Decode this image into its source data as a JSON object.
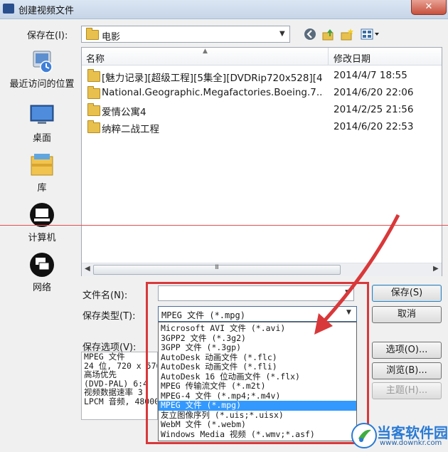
{
  "window": {
    "title": "创建视频文件",
    "close_label": "✕",
    "app_icon_text": ""
  },
  "toolbar": {
    "save_in_label": "保存在(I):",
    "current_folder": "电影"
  },
  "places": [
    {
      "label": "最近访问的位置",
      "icon": "recent-places-icon"
    },
    {
      "label": "桌面",
      "icon": "desktop-icon"
    },
    {
      "label": "库",
      "icon": "libraries-icon"
    },
    {
      "label": "计算机",
      "icon": "computer-icon"
    },
    {
      "label": "网络",
      "icon": "network-icon"
    }
  ],
  "file_list": {
    "columns": {
      "name": "名称",
      "date": "修改日期"
    },
    "rows": [
      {
        "name": "[魅力记录][超级工程][5集全][DVDRip720x528][4...",
        "date": "2014/4/7 18:55"
      },
      {
        "name": "National.Geographic.Megafactories.Boeing.7...",
        "date": "2014/6/20 22:06"
      },
      {
        "name": "爱情公寓4",
        "date": "2014/2/25 21:56"
      },
      {
        "name": "纳粹二战工程",
        "date": "2014/6/20 22:53"
      }
    ],
    "scroll_grip": "III"
  },
  "form": {
    "filename_label": "文件名(N):",
    "filename_value": "",
    "filetype_label": "保存类型(T):",
    "filetype_value": "MPEG 文件 (*.mpg)",
    "save_options_label": "保存选项(V):",
    "save_options_lines": [
      "MPEG 文件",
      "24 位, 720 x 576",
      "高场优先",
      "(DVD-PAL)   6:4",
      "视频数据速率  3",
      "LPCM 音频, 48000"
    ]
  },
  "buttons": {
    "save": "保存(S)",
    "cancel": "取消",
    "options": "选项(O)...",
    "browse": "浏览(B)...",
    "topic": "主题(H)..."
  },
  "filetype_options": [
    {
      "label": "Microsoft AVI 文件 (*.avi)",
      "selected": false
    },
    {
      "label": "3GPP2 文件 (*.3g2)",
      "selected": false
    },
    {
      "label": "3GPP 文件 (*.3gp)",
      "selected": false
    },
    {
      "label": "AutoDesk 动画文件 (*.flc)",
      "selected": false
    },
    {
      "label": "AutoDesk 动画文件 (*.fli)",
      "selected": false
    },
    {
      "label": "AutoDesk 16 位动画文件 (*.flx)",
      "selected": false
    },
    {
      "label": "MPEG 传输流文件 (*.m2t)",
      "selected": false
    },
    {
      "label": "MPEG-4 文件 (*.mp4;*.m4v)",
      "selected": false
    },
    {
      "label": "MPEG 文件 (*.mpg)",
      "selected": true
    },
    {
      "label": "友立图像序列 (*.uis;*.uisx)",
      "selected": false
    },
    {
      "label": "WebM 文件 (*.webm)",
      "selected": false
    },
    {
      "label": "Windows Media 视频 (*.wmv;*.asf)",
      "selected": false
    }
  ],
  "watermark": {
    "name": "当客软件园",
    "url": "www.downkr.com"
  },
  "colors": {
    "selection": "#3399ff",
    "annotation": "#d9383a",
    "folder": "#e8c04d"
  }
}
